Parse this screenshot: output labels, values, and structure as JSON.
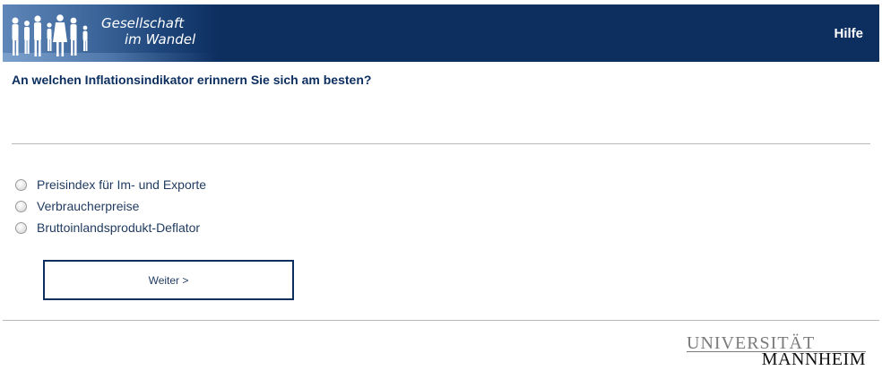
{
  "header": {
    "logo_line1": "Gesellschaft",
    "logo_line2": "im Wandel",
    "help_label": "Hilfe",
    "background_color": "#0d2f60"
  },
  "question": {
    "text": "An welchen Inflationsindikator erinnern Sie sich am besten?"
  },
  "options": [
    {
      "label": "Preisindex für Im- und Exporte",
      "selected": false
    },
    {
      "label": "Verbraucherpreise",
      "selected": false
    },
    {
      "label": "Bruttoinlandsprodukt-Deflator",
      "selected": false
    }
  ],
  "navigation": {
    "next_label": "Weiter >"
  },
  "footer": {
    "university_line1": "UNIVERSITÄT",
    "university_line2": "MANNHEIM"
  }
}
